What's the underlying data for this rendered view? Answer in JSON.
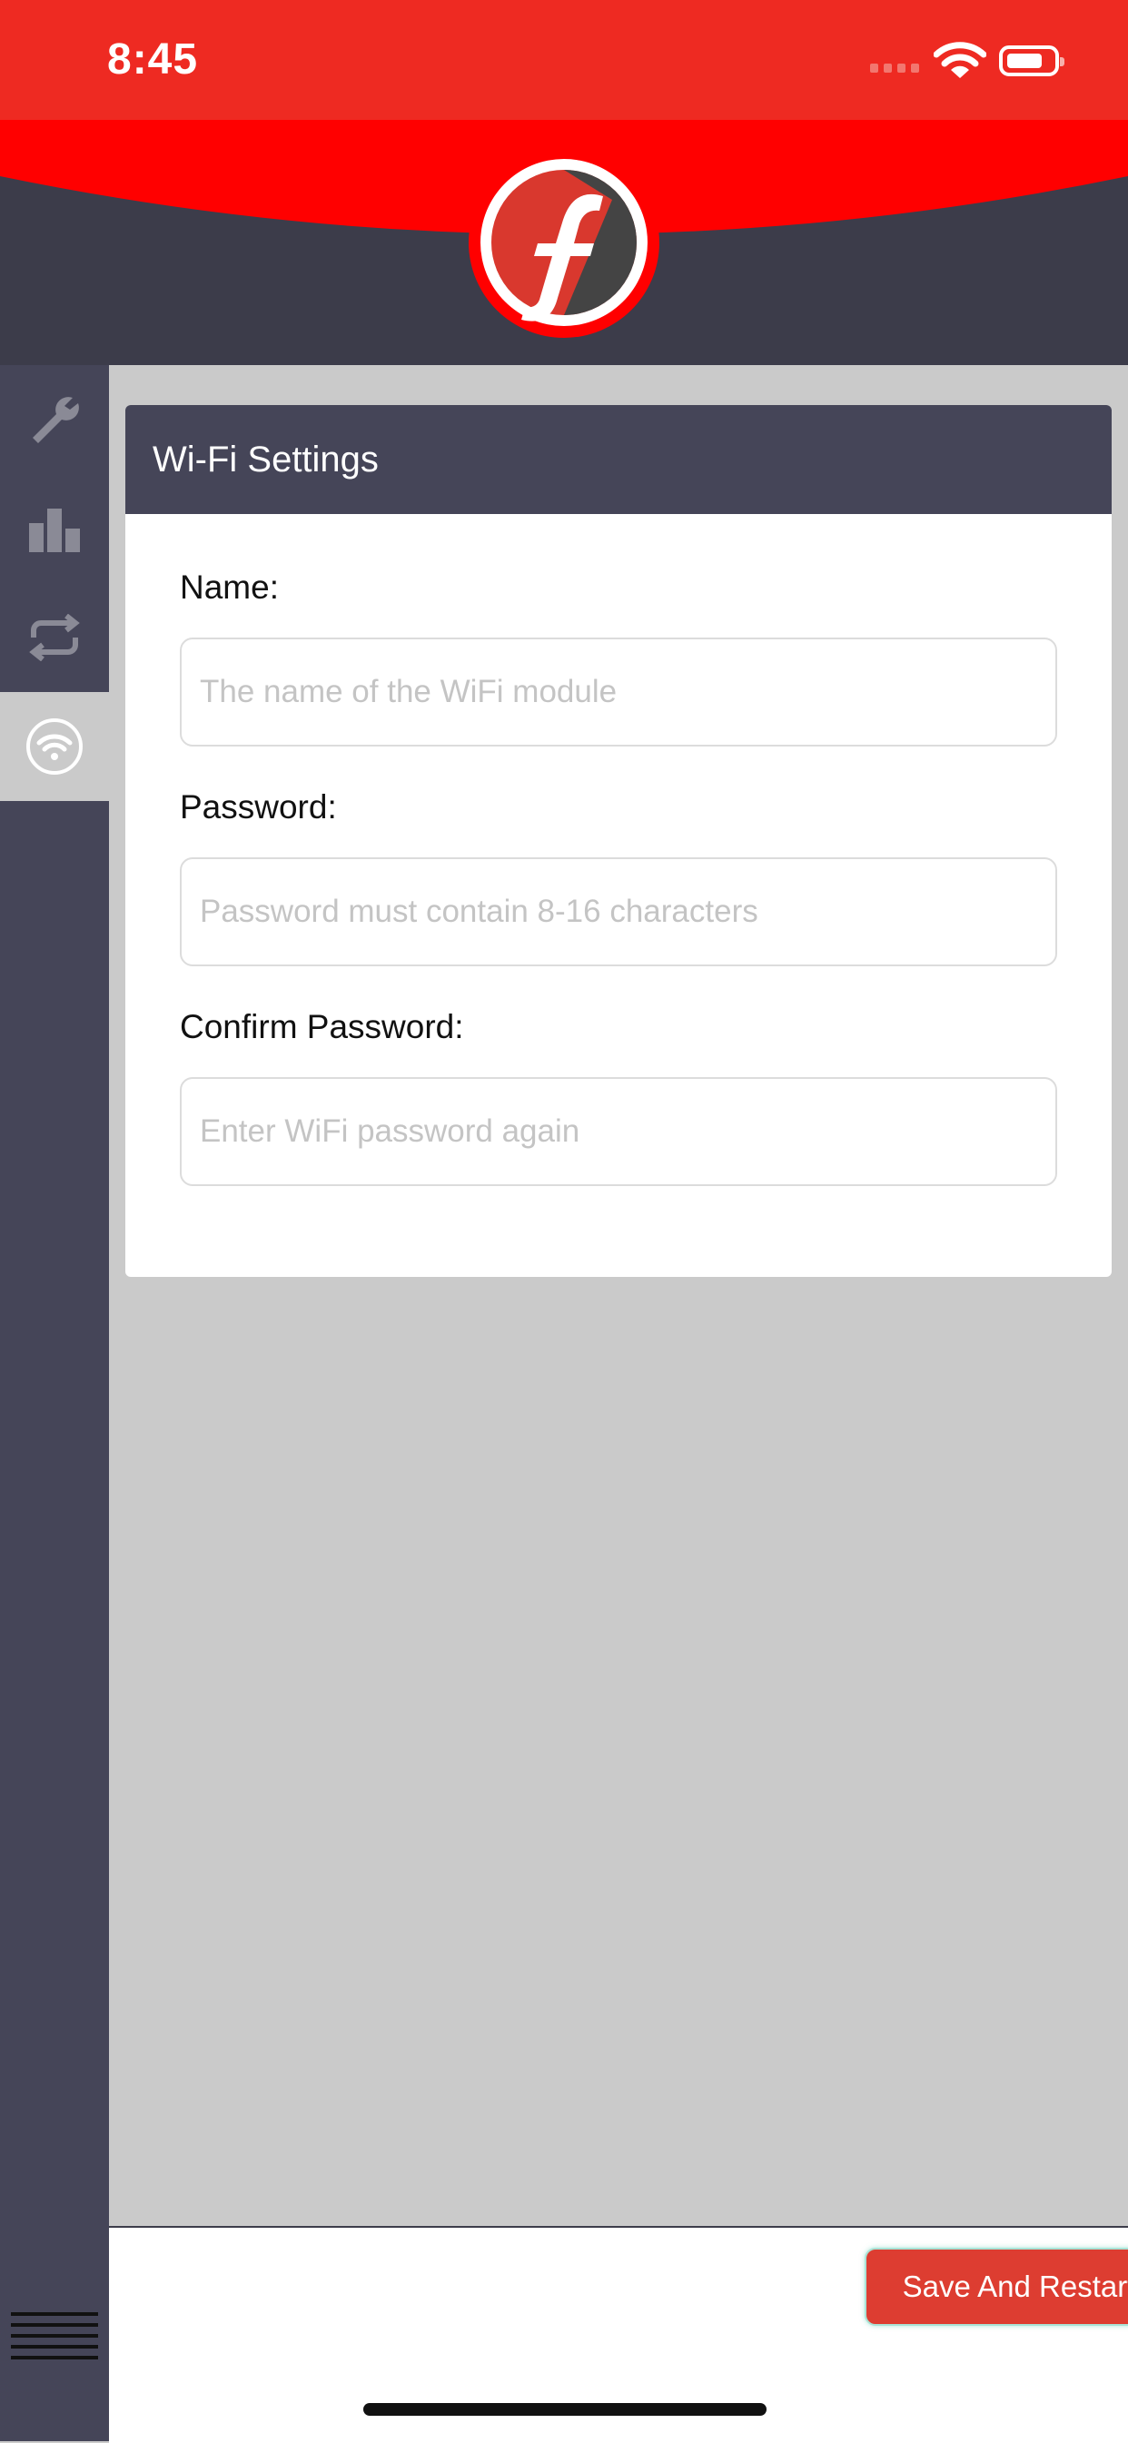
{
  "status_bar": {
    "time": "8:45"
  },
  "colors": {
    "brand_red": "#ee2a22",
    "header_dark": "#3c3c4a",
    "sidebar": "#454558",
    "button": "#dd3d31"
  },
  "sidebar": {
    "items": [
      {
        "icon": "wrench-icon",
        "active": false
      },
      {
        "icon": "bar-chart-icon",
        "active": false
      },
      {
        "icon": "sync-arrows-icon",
        "active": false
      },
      {
        "icon": "wifi-icon",
        "active": true
      }
    ],
    "menu_icon": "hamburger-menu-icon"
  },
  "card": {
    "title": "Wi-Fi Settings",
    "fields": [
      {
        "label": "Name:",
        "value": "",
        "placeholder": "The name of the WiFi module"
      },
      {
        "label": "Password:",
        "value": "",
        "placeholder": "Password must contain 8-16 characters"
      },
      {
        "label": "Confirm Password:",
        "value": "",
        "placeholder": "Enter WiFi password again"
      }
    ]
  },
  "footer": {
    "save_label": "Save And Restart"
  }
}
